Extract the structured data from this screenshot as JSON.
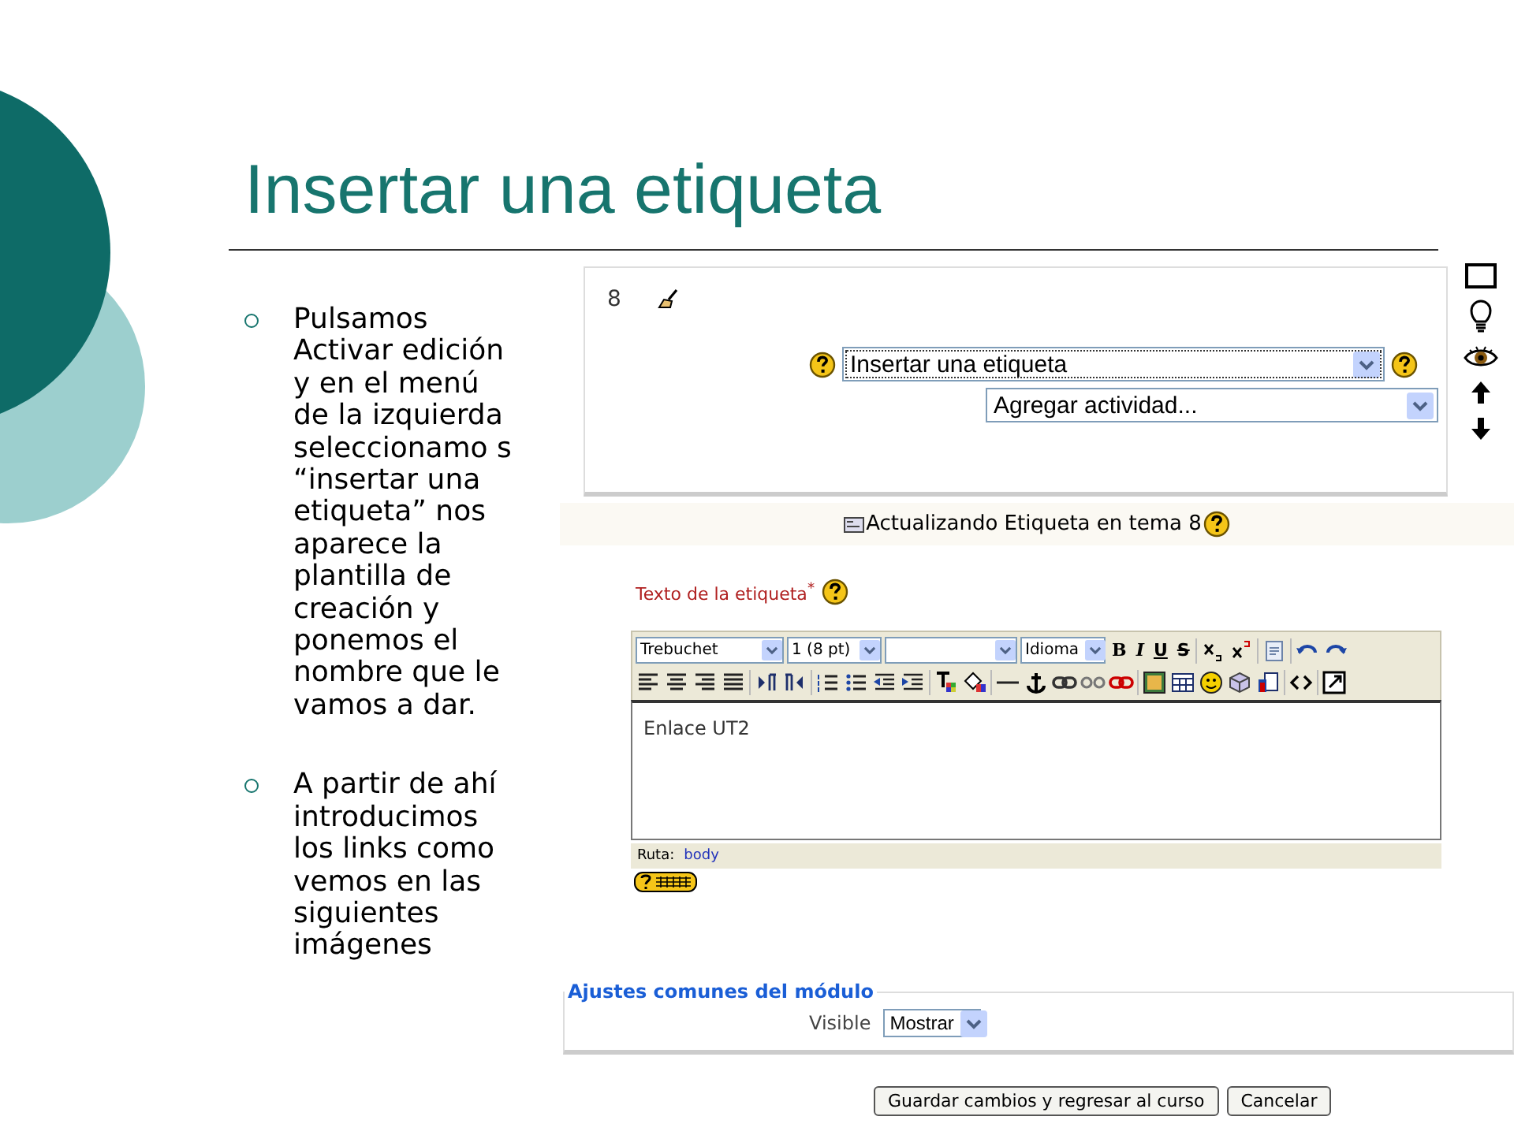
{
  "title": "Insertar una etiqueta",
  "bullets": [
    "Pulsamos Activar edición y en el menú de la izquierda seleccionamo s “insertar una etiqueta” nos aparece la plantilla de creación y ponemos el nombre que le vamos a dar.",
    "A partir de ahí introducimos los links como vemos en las siguientes imágenes"
  ],
  "course_section": {
    "number": "8",
    "activity_select": "Insertar una etiqueta",
    "resource_select": "Agregar actividad..."
  },
  "editor_header": "Actualizando Etiqueta en tema 8",
  "form": {
    "label": "Texto de la etiqueta",
    "required_mark": "*",
    "toolbar": {
      "font": "Trebuchet",
      "size": "1 (8 pt)",
      "language": "Idioma",
      "format_buttons": [
        "B",
        "I",
        "U",
        "S"
      ]
    },
    "content": "Enlace UT2",
    "path_label": "Ruta:",
    "path": "body"
  },
  "settings": {
    "legend": "Ajustes comunes del módulo",
    "visible_label": "Visible",
    "visible_value": "Mostrar"
  },
  "buttons": [
    "Guardar cambios y regresar al curso",
    "Cancelar"
  ]
}
